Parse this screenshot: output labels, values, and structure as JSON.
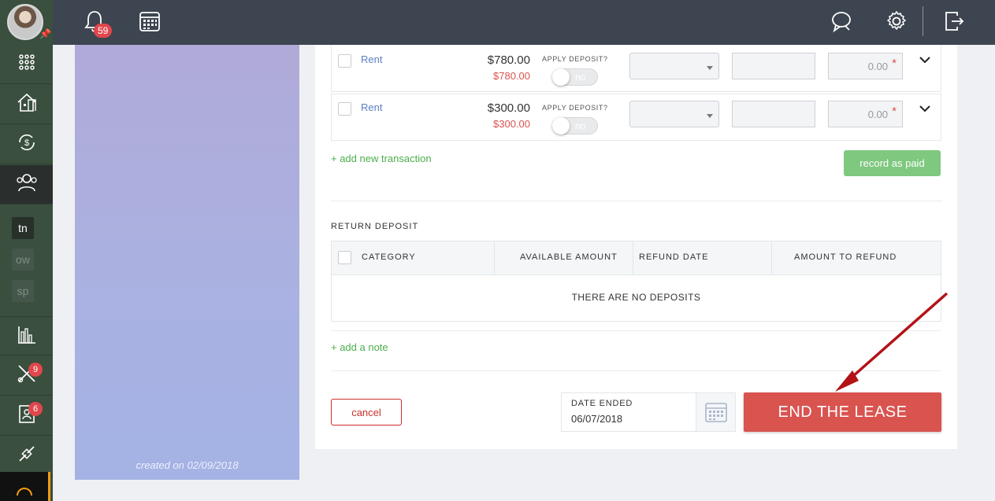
{
  "header": {
    "notifications_count": "59",
    "icons": [
      "bell-icon",
      "calendar-icon",
      "chat-icon",
      "gear-icon",
      "logout-icon"
    ]
  },
  "sidebar": {
    "items": [
      {
        "icon": "apps-grid-icon"
      },
      {
        "icon": "properties-icon"
      },
      {
        "icon": "accounting-icon"
      },
      {
        "icon": "people-icon",
        "active": true
      },
      {
        "icon": "reports-icon"
      },
      {
        "icon": "maintenance-icon",
        "badge": "9"
      },
      {
        "icon": "applications-icon",
        "badge": "6"
      },
      {
        "icon": "links-icon"
      }
    ],
    "chips": [
      "tn",
      "ow",
      "sp"
    ]
  },
  "left_panel": {
    "created": "created on 02/09/2018"
  },
  "transactions": [
    {
      "category": "Rent",
      "amount": "$780.00",
      "due": "$780.00",
      "apply_deposit_label": "APPLY DEPOSIT?",
      "toggle": "no",
      "amount_to_pay": "0.00"
    },
    {
      "category": "Rent",
      "amount": "$300.00",
      "due": "$300.00",
      "apply_deposit_label": "APPLY DEPOSIT?",
      "toggle": "no",
      "amount_to_pay": "0.00"
    }
  ],
  "actions": {
    "add_transaction": "+ add new transaction",
    "record_paid": "record as paid",
    "add_note": "+ add a note",
    "cancel": "cancel",
    "end_lease": "END THE LEASE"
  },
  "return_deposit": {
    "title": "RETURN DEPOSIT",
    "columns": [
      "CATEGORY",
      "AVAILABLE AMOUNT",
      "REFUND DATE",
      "AMOUNT TO REFUND"
    ],
    "empty": "THERE ARE NO DEPOSITS"
  },
  "date_ended": {
    "label": "DATE ENDED",
    "value": "06/07/2018"
  },
  "colors": {
    "topbar": "#3d4550",
    "sidebar": "#3a4f3e",
    "danger": "#d9534f",
    "success": "#7ec87f",
    "link": "#5b7fc0"
  }
}
